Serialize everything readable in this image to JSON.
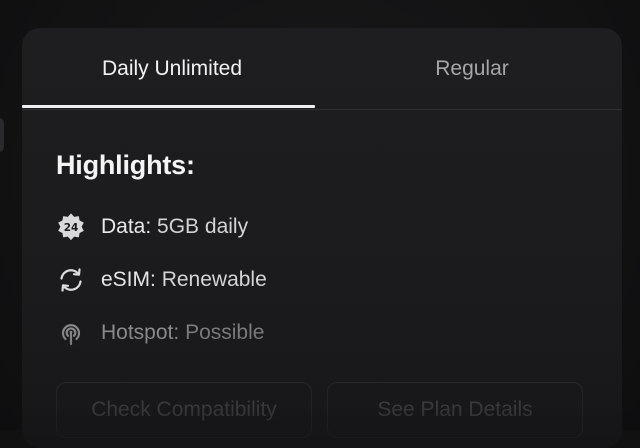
{
  "tabs": [
    {
      "label": "Daily Unlimited",
      "active": true
    },
    {
      "label": "Regular",
      "active": false
    }
  ],
  "highlights": {
    "title": "Highlights:",
    "items": [
      {
        "icon": "24-badge-icon",
        "key": "Data:",
        "value": "5GB daily"
      },
      {
        "icon": "renew-icon",
        "key": "eSIM:",
        "value": "Renewable"
      },
      {
        "icon": "hotspot-icon",
        "key": "Hotspot:",
        "value": "Possible"
      }
    ]
  },
  "buttons": {
    "check_compatibility": "Check Compatibility",
    "see_plan_details": "See Plan Details"
  },
  "badge_text": "24",
  "colors": {
    "card_background": "#1e1e20",
    "active_tab_indicator": "#f0f0f0",
    "text_primary": "#f2f2f2",
    "text_muted": "#a6a6a8"
  }
}
